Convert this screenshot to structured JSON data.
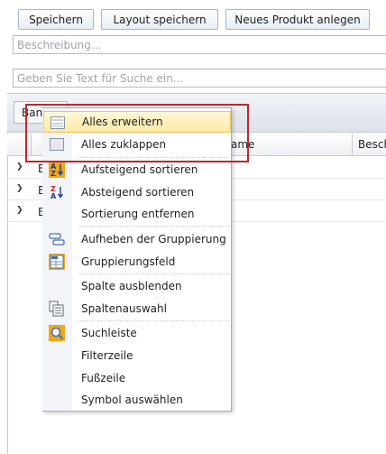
{
  "toolbar": {
    "save_label": "Speichern",
    "save_layout_label": "Layout speichern",
    "new_product_label": "Neues Produkt anlegen"
  },
  "description": {
    "placeholder": "Beschreibung..."
  },
  "search": {
    "placeholder": "Geben Sie Text für Suche ein..."
  },
  "group_panel": {
    "chip_label": "Ban"
  },
  "grid": {
    "columns": [
      "ame",
      "Besch"
    ],
    "rows": [
      {
        "text": "E"
      },
      {
        "text": "E"
      },
      {
        "text": "E"
      }
    ]
  },
  "context_menu": {
    "items": [
      {
        "label": "Alles erweitern",
        "icon": "expand-all-icon",
        "highlighted": true
      },
      {
        "label": "Alles zuklappen",
        "icon": "collapse-all-icon"
      },
      {
        "label": "Aufsteigend sortieren",
        "icon": "sort-ascending-icon"
      },
      {
        "label": "Absteigend sortieren",
        "icon": "sort-descending-icon"
      },
      {
        "label": "Sortierung entfernen",
        "icon": ""
      },
      {
        "label": "Aufheben der Gruppierung",
        "icon": "ungroup-icon"
      },
      {
        "label": "Gruppierungsfeld",
        "icon": "group-panel-icon"
      },
      {
        "label": "Spalte ausblenden",
        "icon": ""
      },
      {
        "label": "Spaltenauswahl",
        "icon": "column-chooser-icon"
      },
      {
        "label": "Suchleiste",
        "icon": "search-panel-icon"
      },
      {
        "label": "Filterzeile",
        "icon": ""
      },
      {
        "label": "Fußzeile",
        "icon": ""
      },
      {
        "label": "Symbol auswählen",
        "icon": ""
      }
    ]
  },
  "colors": {
    "highlight": "#fde9a2",
    "annotation": "#c0262b",
    "accent_icon": "#f0a818"
  }
}
